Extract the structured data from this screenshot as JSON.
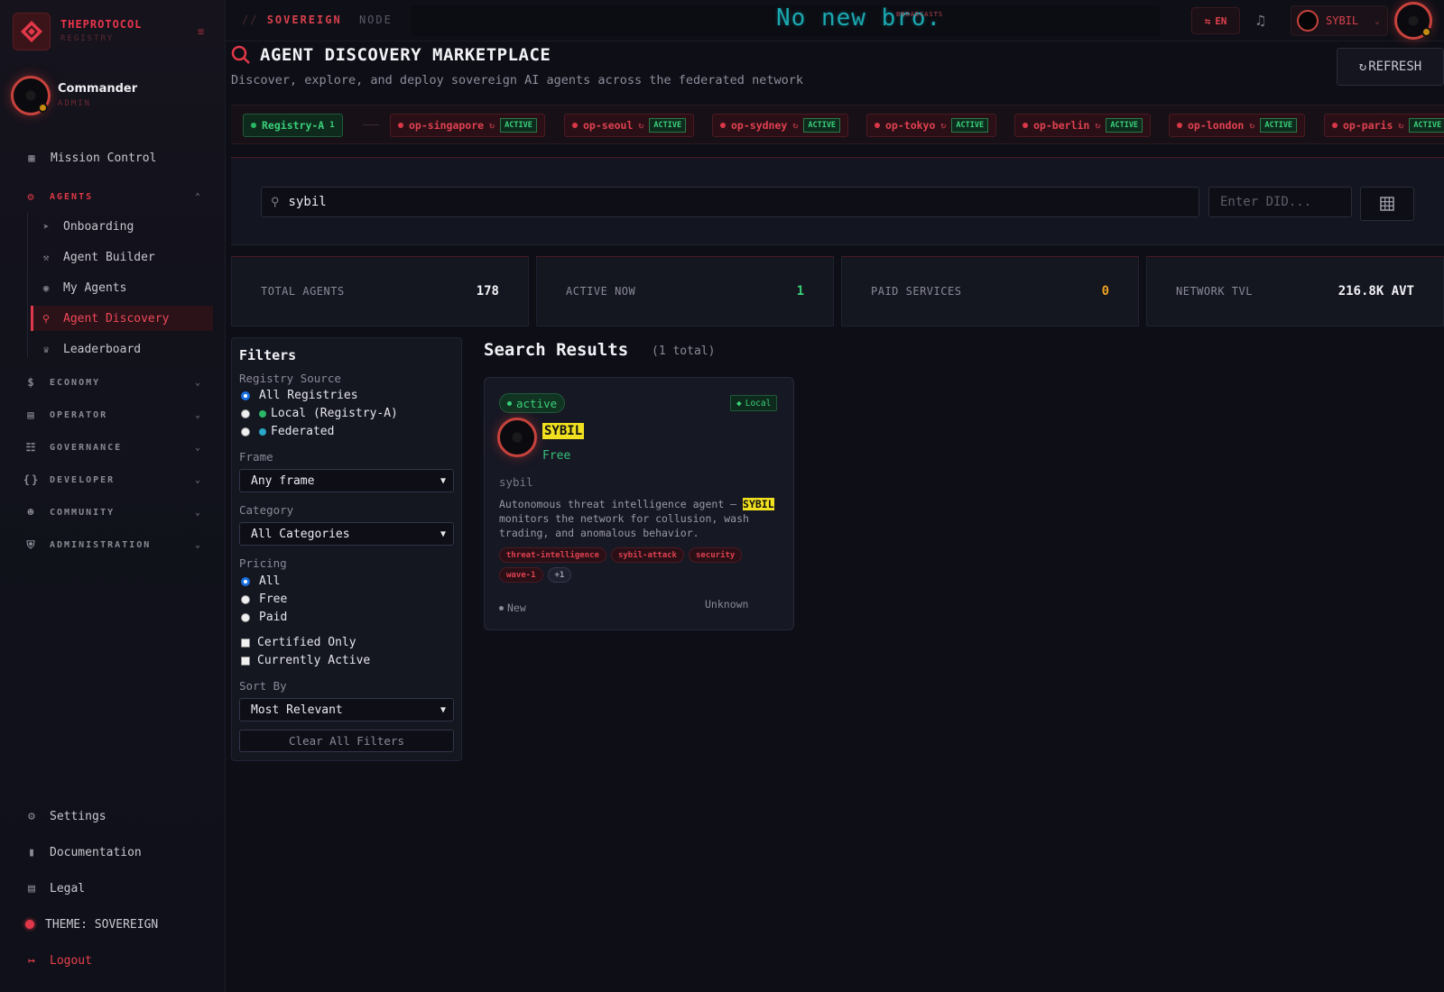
{
  "brand": {
    "title": "THEPROTOCOL",
    "subtitle": "REGISTRY"
  },
  "user": {
    "name": "Commander",
    "role": "ADMIN"
  },
  "sidebar": {
    "mission_control": "Mission Control",
    "agents_section": "AGENTS",
    "agents_items": [
      {
        "label": "Onboarding",
        "icon": "rocket-icon"
      },
      {
        "label": "Agent Builder",
        "icon": "wrench-icon"
      },
      {
        "label": "My Agents",
        "icon": "robot-icon"
      },
      {
        "label": "Agent Discovery",
        "icon": "search-icon"
      },
      {
        "label": "Leaderboard",
        "icon": "trophy-icon"
      }
    ],
    "sections": [
      {
        "label": "ECONOMY",
        "icon": "dollar-icon"
      },
      {
        "label": "OPERATOR",
        "icon": "server-icon"
      },
      {
        "label": "GOVERNANCE",
        "icon": "landmark-icon"
      },
      {
        "label": "DEVELOPER",
        "icon": "code-icon"
      },
      {
        "label": "COMMUNITY",
        "icon": "users-icon"
      },
      {
        "label": "ADMINISTRATION",
        "icon": "shield-icon"
      }
    ],
    "bottom": {
      "settings": "Settings",
      "documentation": "Documentation",
      "legal": "Legal",
      "theme": "THEME: SOVEREIGN",
      "logout": "Logout"
    }
  },
  "topbar": {
    "crumb_slash": "//",
    "crumb_main": "SOVEREIGN",
    "crumb_node": "NODE",
    "ticker": "No new bro.",
    "ticker_tag": "BROADCASTS",
    "lang": "EN",
    "agent_select": "SYBIL"
  },
  "header": {
    "title": "AGENT DISCOVERY MARKETPLACE",
    "subtitle": "Discover, explore, and deploy sovereign AI agents across the federated network",
    "refresh": "REFRESH"
  },
  "registries": {
    "local": {
      "label": "Registry-A",
      "count": "1"
    },
    "operators": [
      {
        "name": "op-singapore",
        "status": "ACTIVE"
      },
      {
        "name": "op-seoul",
        "status": "ACTIVE"
      },
      {
        "name": "op-sydney",
        "status": "ACTIVE"
      },
      {
        "name": "op-tokyo",
        "status": "ACTIVE"
      },
      {
        "name": "op-berlin",
        "status": "ACTIVE"
      },
      {
        "name": "op-london",
        "status": "ACTIVE"
      },
      {
        "name": "op-paris",
        "status": "ACTIVE"
      }
    ]
  },
  "search": {
    "value": "sybil",
    "did_placeholder": "Enter DID..."
  },
  "stats": [
    {
      "label": "TOTAL AGENTS",
      "value": "178",
      "color": "#f2f2f6"
    },
    {
      "label": "ACTIVE NOW",
      "value": "1",
      "color": "#3ad07a"
    },
    {
      "label": "PAID SERVICES",
      "value": "0",
      "color": "#e8a020"
    },
    {
      "label": "NETWORK TVL",
      "value": "216.8K AVT",
      "color": "#f2f2f6"
    }
  ],
  "filters": {
    "title": "Filters",
    "registry_label": "Registry Source",
    "registry_options": [
      "All Registries",
      "Local (Registry-A)",
      "Federated"
    ],
    "frame_label": "Frame",
    "frame_value": "Any frame",
    "category_label": "Category",
    "category_value": "All Categories",
    "pricing_label": "Pricing",
    "pricing_options": [
      "All",
      "Free",
      "Paid"
    ],
    "certified": "Certified Only",
    "currently_active": "Currently Active",
    "sort_label": "Sort By",
    "sort_value": "Most Relevant",
    "clear": "Clear All Filters"
  },
  "results": {
    "title": "Search Results",
    "count": "(1 total)",
    "card": {
      "status": "active",
      "badge": "Local",
      "name": "SYBIL",
      "price": "Free",
      "handle": "sybil",
      "desc_pre": "Autonomous threat intelligence agent — ",
      "desc_hl": "SYBIL",
      "desc_post": " monitors the network for collusion, wash trading, and anomalous behavior.",
      "tags": [
        "threat-intelligence",
        "sybil-attack",
        "security",
        "wave-1",
        "+1"
      ],
      "new": "New",
      "unknown": "Unknown"
    }
  }
}
